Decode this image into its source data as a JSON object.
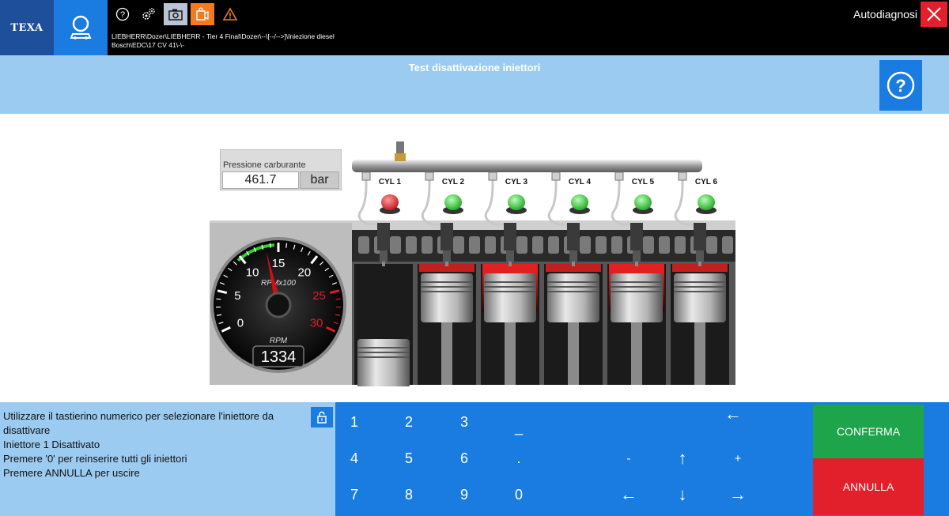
{
  "header": {
    "logo": "TEXA",
    "app_title": "Autodiagnosi",
    "breadcrumb_line1": "LIEBHERR\\Dozer\\LIEBHERR - Tier 4 Final\\Dozer\\--\\[--/-->]\\Iniezione diesel",
    "breadcrumb_line2": "Bosch\\EDC\\17 CV 41\\-\\-",
    "icons": [
      "vehicle-search-icon",
      "help-icon",
      "gears-icon",
      "camera-icon",
      "recorder-icon",
      "warning-icon",
      "close-icon"
    ]
  },
  "page": {
    "title": "Test disattivazione iniettori"
  },
  "pressure": {
    "label": "Pressione carburante",
    "value": "461.7",
    "unit": "bar"
  },
  "tachometer": {
    "ticks": [
      "0",
      "5",
      "10",
      "15",
      "20",
      "25",
      "30"
    ],
    "scale_label": "RPMx100",
    "unit_label": "RPM",
    "value": "1334",
    "rpm": 1334,
    "max_rpm_hundreds": 30
  },
  "cylinders": [
    {
      "label": "CYL 1",
      "status": "off",
      "active": false
    },
    {
      "label": "CYL 2",
      "status": "on",
      "active": false
    },
    {
      "label": "CYL 3",
      "status": "on",
      "active": true
    },
    {
      "label": "CYL 4",
      "status": "on",
      "active": false
    },
    {
      "label": "CYL 5",
      "status": "on",
      "active": true
    },
    {
      "label": "CYL 6",
      "status": "on",
      "active": false
    }
  ],
  "colors": {
    "led_off": "#e01b24",
    "led_on": "#2fd12f",
    "accent": "#1a7be0",
    "light_panel": "#9ccbf1",
    "confirm": "#1ea54b",
    "cancel": "#e2202c"
  },
  "messages": {
    "line1": "Utilizzare il tastierino numerico per selezionare l'iniettore da disattivare",
    "line2": "Iniettore 1 Disattivato",
    "line3": "Premere '0' per reinserire tutti gli iniettori",
    "line4": "Premere ANNULLA per uscire"
  },
  "keypad": {
    "k1": "1",
    "k2": "2",
    "k3": "3",
    "underscore": "_",
    "k4": "4",
    "k5": "5",
    "k6": "6",
    "dot": ".",
    "k7": "7",
    "k8": "8",
    "k9": "9",
    "k0": "0",
    "minus": "-",
    "plus": "+",
    "backspace": "←",
    "up": "↑",
    "down": "↓",
    "left": "←",
    "right": "→"
  },
  "actions": {
    "confirm": "CONFERMA",
    "cancel": "ANNULLA"
  }
}
